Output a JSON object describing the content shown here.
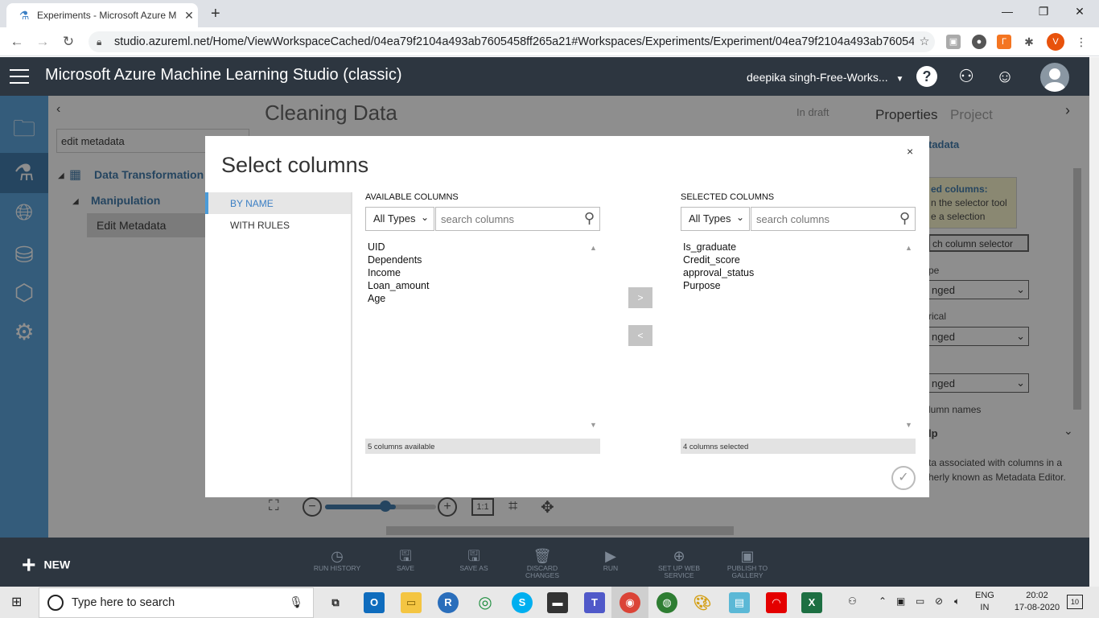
{
  "browser": {
    "tab_title": "Experiments - Microsoft Azure M",
    "url": "studio.azureml.net/Home/ViewWorkspaceCached/04ea79f2104a493ab7605458ff265a21#Workspaces/Experiments/Experiment/04ea79f2104a493ab7605458f...",
    "profile_initial": "V"
  },
  "app": {
    "title": "Microsoft Azure Machine Learning Studio (classic)",
    "user": "deepika singh-Free-Works..."
  },
  "palette": {
    "search_value": "edit metadata",
    "tree": {
      "group": "Data Transformation",
      "subgroup": "Manipulation",
      "item": "Edit Metadata"
    }
  },
  "canvas": {
    "title": "Cleaning Data",
    "status": "In draft"
  },
  "right_panel": {
    "tab_properties": "Properties",
    "tab_project": "Project",
    "module_name": "tadata",
    "selected_cols_label": "ed columns:",
    "selector_hint_1": "n the selector tool",
    "selector_hint_2": "e a selection",
    "launch_btn": "ch column selector",
    "field1_label": "pe",
    "field1_value": "nged",
    "field2_label": "rical",
    "field2_value": "nged",
    "field3_value": "nged",
    "field4_label": "lumn names",
    "help_title": "lp",
    "help_line1": "ta associated with columns in a",
    "help_line2": "herly known as Metadata Editor."
  },
  "dialog": {
    "title": "Select columns",
    "close": "×",
    "tab_by_name": "BY NAME",
    "tab_with_rules": "WITH RULES",
    "available": {
      "header": "AVAILABLE COLUMNS",
      "type_filter": "All Types",
      "search_placeholder": "search columns",
      "items": [
        "UID",
        "Dependents",
        "Income",
        "Loan_amount",
        "Age"
      ],
      "footer": "5 columns available"
    },
    "selected": {
      "header": "SELECTED COLUMNS",
      "type_filter": "All Types",
      "search_placeholder": "search columns",
      "items": [
        "Is_graduate",
        "Credit_score",
        "approval_status",
        "Purpose"
      ],
      "footer": "4 columns selected"
    },
    "move_right": ">",
    "move_left": "<"
  },
  "canvas_tools": {
    "fit": "1:1"
  },
  "toolbar": {
    "new": "NEW",
    "run_history": "RUN HISTORY",
    "save": "SAVE",
    "save_as": "SAVE AS",
    "discard": "DISCARD CHANGES",
    "run": "RUN",
    "setup_web_1": "SET UP WEB",
    "setup_web_2": "SERVICE",
    "publish_1": "PUBLISH TO",
    "publish_2": "GALLERY"
  },
  "taskbar": {
    "search_placeholder": "Type here to search",
    "lang_1": "ENG",
    "lang_2": "IN",
    "time": "20:02",
    "date": "17-08-2020",
    "notifications": "10"
  }
}
